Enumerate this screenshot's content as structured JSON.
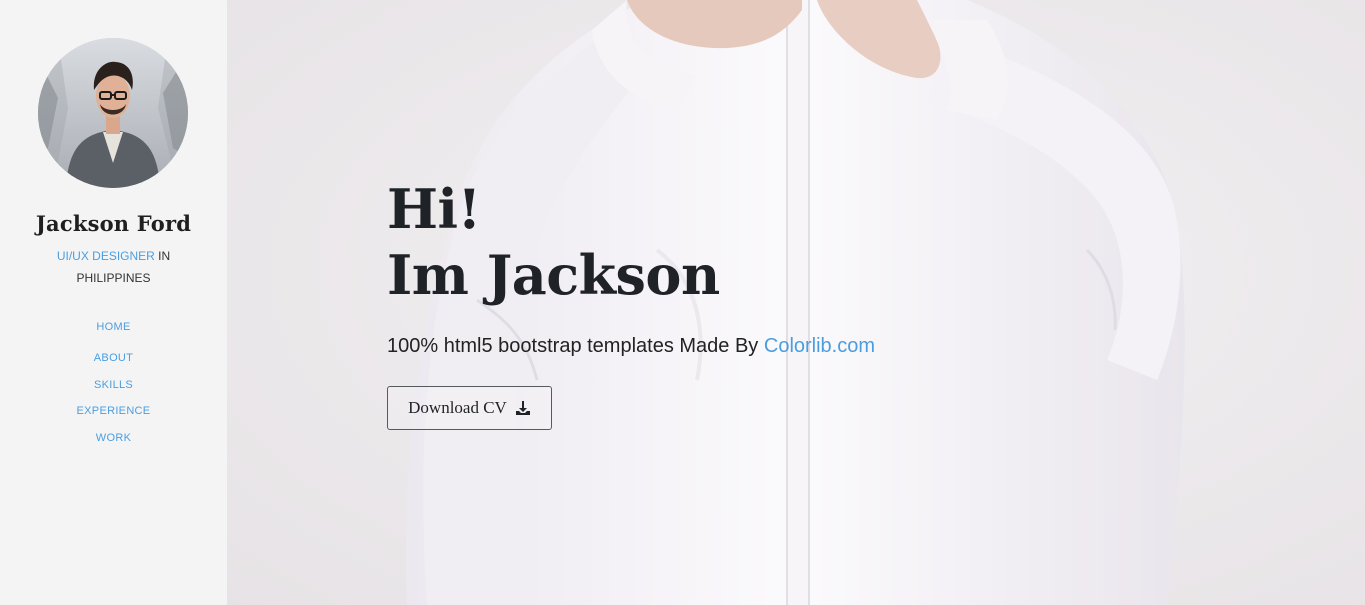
{
  "sidebar": {
    "name": "Jackson Ford",
    "role_accent": "UI/UX DESIGNER",
    "role_rest": " IN PHILIPPINES",
    "nav": [
      {
        "label": "HOME"
      },
      {
        "label": "ABOUT"
      },
      {
        "label": "SKILLS"
      },
      {
        "label": "EXPERIENCE"
      },
      {
        "label": "WORK"
      }
    ]
  },
  "hero": {
    "greeting": "Hi!",
    "intro": "Im Jackson",
    "subtitle_text": "100% html5 bootstrap templates Made By ",
    "subtitle_link": "Colorlib.com",
    "button_label": "Download CV",
    "button_icon": "download-icon"
  },
  "colors": {
    "accent": "#4a9ee0",
    "sidebar_bg": "#f4f4f5",
    "text_dark": "#1f2328"
  }
}
